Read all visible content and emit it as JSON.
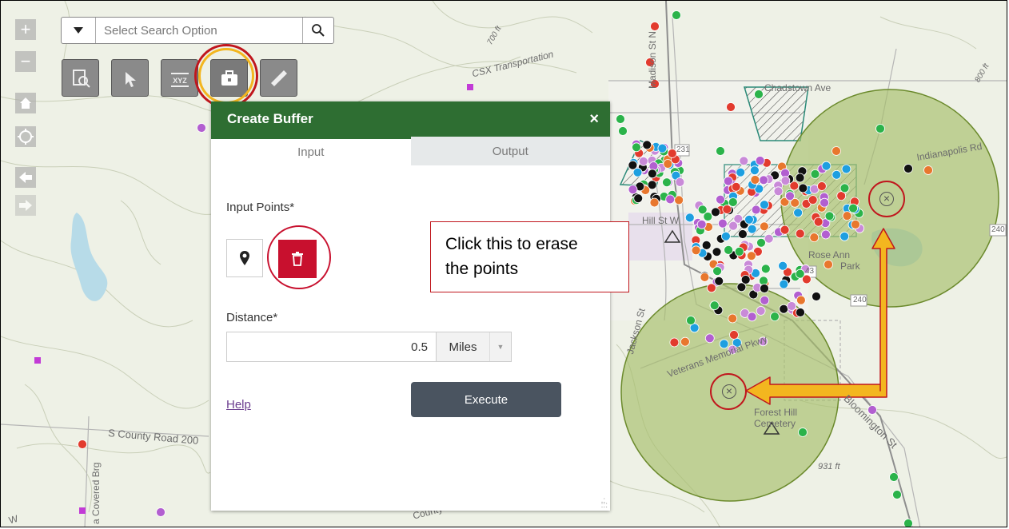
{
  "search": {
    "placeholder": "Select Search Option"
  },
  "toolbar": {
    "tools": [
      "query-tool",
      "select-tool",
      "coordinate-tool",
      "toolbox-tool",
      "measure-tool"
    ],
    "coordinate_label": "XYZ"
  },
  "nav": {
    "zoom_in": "+",
    "zoom_out": "−"
  },
  "panel": {
    "title": "Create Buffer",
    "close": "×",
    "tabs": [
      {
        "label": "Input",
        "selected": true
      },
      {
        "label": "Output",
        "selected": false
      }
    ],
    "input_points_label": "Input Points*",
    "distance_label": "Distance*",
    "distance_value": "0.5",
    "unit": "Miles",
    "help": "Help",
    "execute": "Execute"
  },
  "callout": {
    "line1": "Click this to erase",
    "line2": "the points"
  },
  "map_labels": {
    "csx": "CSX Transportation",
    "madison": "Madison St N",
    "chadstown": "Chadstown Ave",
    "indianapolis": "Indianapolis Rd",
    "hill": "Hill St W",
    "rose_ann": "Rose Ann",
    "park": "Park",
    "veterans": "Veterans Memorial Pkwy",
    "jackson": "Jackson St",
    "forest_hill": "Forest Hill",
    "cemetery": "Cemetery",
    "bloomington": "Bloomington St",
    "county_road": "S County Road 200",
    "covered_brg": "a Covered Brg",
    "county": "County",
    "elev_700": "700 ft",
    "elev_800": "800 ft",
    "elev_931": "931 ft",
    "hwy_231": "231",
    "hwy_240a": "240",
    "hwy_240b": "240",
    "hwy_43": "43",
    "w": "W"
  },
  "colors": {
    "panel_header": "#2e6e32",
    "delete_button": "#c8102e",
    "execute_button": "#4a5460",
    "buffer_fill": "#a6bf6a",
    "highlight_ring": "#c0161d",
    "arrow_fill": "#f3b61f"
  }
}
